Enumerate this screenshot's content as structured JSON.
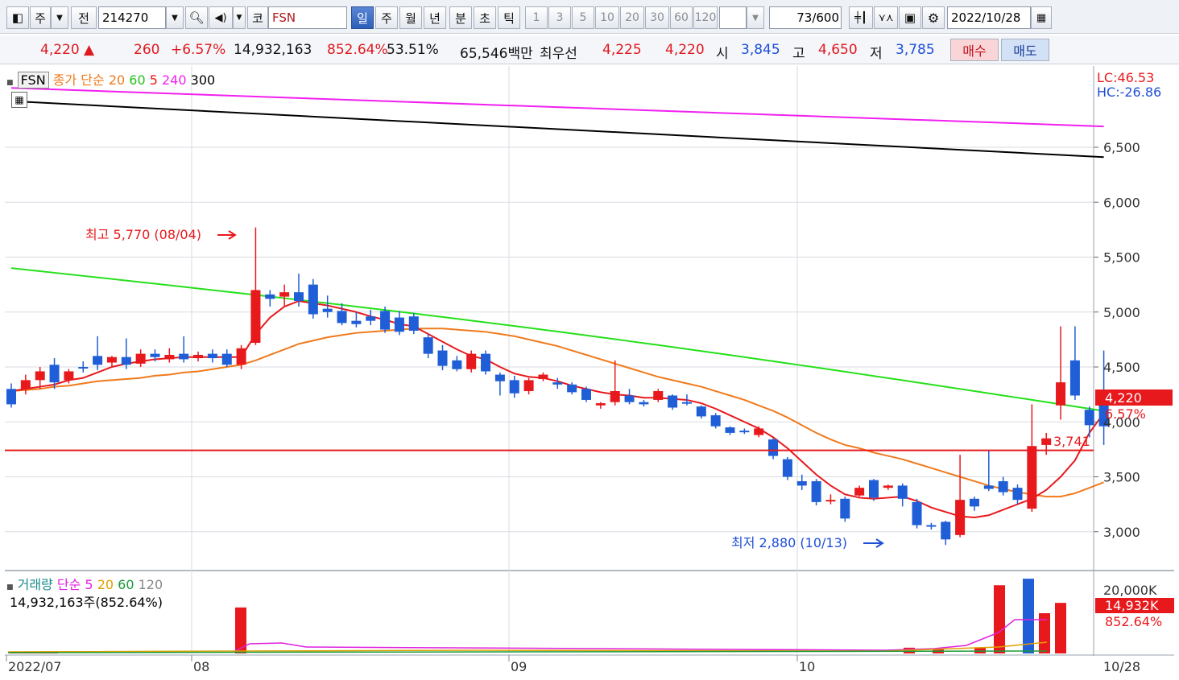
{
  "toolbar": {
    "period": "주",
    "prev_label": "전",
    "code": "214270",
    "market_badge": "코",
    "name": "FSN",
    "intervals": [
      "일",
      "주",
      "월",
      "년",
      "분",
      "초",
      "틱"
    ],
    "active_interval": "일",
    "minute_options": [
      "1",
      "3",
      "5",
      "10",
      "20",
      "30",
      "60",
      "120"
    ],
    "count": "73",
    "count_max": "/600",
    "date": "2022/10/28"
  },
  "quote": {
    "price": "4,220",
    "direction": "▲",
    "change": "260",
    "change_pct": "+6.57%",
    "volume": "14,932,163",
    "volume_ratio": "852.64%",
    "turnover_ratio": "53.51%",
    "amount": "65,546백만",
    "best_quote_label": "최우선",
    "ask": "4,225",
    "bid": "4,220",
    "open_label": "시",
    "open": "3,845",
    "high_label": "고",
    "high": "4,650",
    "low_label": "저",
    "low": "3,785",
    "buy_label": "매수",
    "sell_label": "매도"
  },
  "legend": {
    "name_tag": "FSN",
    "ma_title": "종가 단순",
    "ma_periods": [
      "20",
      "60",
      "5",
      "240",
      "300"
    ],
    "volume_title": "거래량",
    "volume_ma_title": "단순",
    "volume_ma_periods": [
      "5",
      "20",
      "60",
      "120"
    ],
    "volume_summary": "14,932,163주(852.64%)"
  },
  "axis": {
    "lc": "LC:46.53",
    "hc": "HC:-26.86",
    "price_ticks": [
      "6,500",
      "6,000",
      "5,500",
      "5,000",
      "4,500",
      "4,000",
      "3,500",
      "3,000"
    ],
    "current_price_tag": "4,220",
    "current_pct_tag": "6.57%",
    "volume_ticks": [
      "20,000K"
    ],
    "current_volume_tag": "14,932K",
    "current_volume_pct": "852.64%",
    "date_labels": [
      "2022/07",
      "08",
      "09",
      "10"
    ],
    "last_date": "10/28"
  },
  "annotations": {
    "high": "최고 5,770 (08/04)",
    "low": "최저 2,880 (10/13)",
    "hline_value": "3,741"
  },
  "colors": {
    "up": "#e8191c",
    "down": "#1f5ed6",
    "ma5": "#e8191c",
    "ma20": "#f07a1c",
    "ma60": "#25e01a",
    "ma240": "#f020f0",
    "ma300": "#000000"
  },
  "chart_data": {
    "type": "candlestick",
    "price_ylim": [
      2750,
      7000
    ],
    "hline": 3741,
    "candles": [
      [
        4300,
        4160,
        4130,
        4350
      ],
      [
        4300,
        4380,
        4250,
        4430
      ],
      [
        4380,
        4460,
        4300,
        4500
      ],
      [
        4520,
        4360,
        4300,
        4580
      ],
      [
        4380,
        4460,
        4350,
        4480
      ],
      [
        4500,
        4490,
        4450,
        4550
      ],
      [
        4600,
        4520,
        4470,
        4780
      ],
      [
        4540,
        4590,
        4500,
        4600
      ],
      [
        4590,
        4520,
        4480,
        4760
      ],
      [
        4530,
        4620,
        4500,
        4660
      ],
      [
        4620,
        4590,
        4550,
        4660
      ],
      [
        4570,
        4610,
        4540,
        4670
      ],
      [
        4620,
        4570,
        4540,
        4780
      ],
      [
        4580,
        4610,
        4550,
        4640
      ],
      [
        4620,
        4580,
        4540,
        4660
      ],
      [
        4620,
        4520,
        4500,
        4660
      ],
      [
        4520,
        4670,
        4480,
        4700
      ],
      [
        4720,
        5200,
        4700,
        5770
      ],
      [
        5160,
        5120,
        5050,
        5200
      ],
      [
        5140,
        5180,
        5050,
        5250
      ],
      [
        5180,
        5100,
        5050,
        5350
      ],
      [
        5250,
        4980,
        4940,
        5300
      ],
      [
        5030,
        5000,
        4950,
        5150
      ],
      [
        5010,
        4900,
        4880,
        5080
      ],
      [
        4920,
        4890,
        4860,
        5000
      ],
      [
        4960,
        4920,
        4880,
        5020
      ],
      [
        5010,
        4840,
        4810,
        5050
      ],
      [
        4950,
        4820,
        4790,
        5010
      ],
      [
        4960,
        4830,
        4800,
        4990
      ],
      [
        4770,
        4620,
        4580,
        4800
      ],
      [
        4650,
        4510,
        4470,
        4700
      ],
      [
        4560,
        4480,
        4460,
        4600
      ],
      [
        4480,
        4620,
        4450,
        4650
      ],
      [
        4620,
        4460,
        4430,
        4650
      ],
      [
        4430,
        4370,
        4240,
        4450
      ],
      [
        4380,
        4260,
        4220,
        4420
      ],
      [
        4280,
        4380,
        4250,
        4400
      ],
      [
        4390,
        4430,
        4370,
        4450
      ],
      [
        4360,
        4340,
        4300,
        4400
      ],
      [
        4340,
        4270,
        4250,
        4360
      ],
      [
        4300,
        4200,
        4180,
        4320
      ],
      [
        4150,
        4170,
        4120,
        4180
      ],
      [
        4180,
        4280,
        4150,
        4560
      ],
      [
        4240,
        4180,
        4160,
        4300
      ],
      [
        4180,
        4160,
        4140,
        4200
      ],
      [
        4200,
        4280,
        4180,
        4300
      ],
      [
        4240,
        4130,
        4110,
        4250
      ],
      [
        4180,
        4170,
        4150,
        4250
      ],
      [
        4140,
        4050,
        4030,
        4150
      ],
      [
        4060,
        3960,
        3940,
        4080
      ],
      [
        3950,
        3900,
        3880,
        3960
      ],
      [
        3920,
        3910,
        3890,
        3940
      ],
      [
        3880,
        3940,
        3860,
        3960
      ],
      [
        3840,
        3690,
        3660,
        3850
      ],
      [
        3660,
        3500,
        3470,
        3680
      ],
      [
        3460,
        3420,
        3380,
        3520
      ],
      [
        3460,
        3270,
        3240,
        3480
      ],
      [
        3280,
        3290,
        3250,
        3340
      ],
      [
        3300,
        3120,
        3090,
        3320
      ],
      [
        3330,
        3400,
        3320,
        3420
      ],
      [
        3470,
        3310,
        3280,
        3480
      ],
      [
        3400,
        3420,
        3380,
        3430
      ],
      [
        3420,
        3300,
        3230,
        3440
      ],
      [
        3270,
        3060,
        3030,
        3300
      ],
      [
        3060,
        3050,
        3020,
        3080
      ],
      [
        3090,
        2930,
        2880,
        3100
      ],
      [
        2970,
        3290,
        2950,
        3700
      ],
      [
        3300,
        3230,
        3190,
        3320
      ],
      [
        3420,
        3390,
        3370,
        3740
      ],
      [
        3460,
        3360,
        3330,
        3500
      ],
      [
        3400,
        3290,
        3250,
        3430
      ],
      [
        3210,
        3780,
        3180,
        4160
      ],
      [
        3790,
        3850,
        3700,
        3900
      ],
      [
        4150,
        4360,
        4020,
        4870
      ],
      [
        4560,
        4240,
        4200,
        4870
      ],
      [
        4110,
        3970,
        3860,
        4140
      ],
      [
        4220,
        3960,
        3790,
        4650
      ]
    ],
    "ma5": [
      4280,
      4300,
      4320,
      4340,
      4380,
      4400,
      4450,
      4500,
      4530,
      4550,
      4570,
      4580,
      4590,
      4590,
      4590,
      4590,
      4590,
      4800,
      4950,
      5050,
      5100,
      5080,
      5060,
      5030,
      5000,
      4960,
      4930,
      4890,
      4870,
      4800,
      4730,
      4660,
      4600,
      4570,
      4500,
      4440,
      4410,
      4400,
      4370,
      4330,
      4300,
      4270,
      4250,
      4240,
      4220,
      4220,
      4210,
      4200,
      4170,
      4120,
      4060,
      4000,
      3940,
      3860,
      3760,
      3640,
      3520,
      3420,
      3340,
      3310,
      3300,
      3310,
      3320,
      3280,
      3220,
      3180,
      3140,
      3130,
      3150,
      3200,
      3250,
      3300,
      3380,
      3500,
      3650,
      3900,
      4080
    ],
    "ma20": [
      4280,
      4290,
      4300,
      4320,
      4330,
      4350,
      4370,
      4380,
      4390,
      4400,
      4420,
      4430,
      4450,
      4460,
      4480,
      4500,
      4520,
      4560,
      4610,
      4660,
      4710,
      4740,
      4770,
      4790,
      4810,
      4820,
      4830,
      4840,
      4850,
      4850,
      4850,
      4840,
      4830,
      4820,
      4800,
      4780,
      4750,
      4720,
      4690,
      4650,
      4610,
      4570,
      4530,
      4490,
      4450,
      4410,
      4380,
      4350,
      4320,
      4280,
      4240,
      4200,
      4150,
      4100,
      4040,
      3970,
      3900,
      3840,
      3790,
      3760,
      3720,
      3690,
      3660,
      3620,
      3580,
      3540,
      3500,
      3460,
      3420,
      3390,
      3360,
      3340,
      3320,
      3320,
      3350,
      3400,
      3450
    ]
  },
  "volume_data": {
    "ylim": [
      0,
      21000
    ],
    "bars": [
      [
        0,
        250
      ],
      [
        26,
        300
      ],
      [
        278,
        12000
      ],
      [
        1108,
        1500
      ],
      [
        1144,
        1200
      ],
      [
        1196,
        1600
      ],
      [
        1220,
        17800
      ],
      [
        1256,
        19500
      ],
      [
        1276,
        10500
      ],
      [
        1296,
        13200
      ]
    ]
  }
}
